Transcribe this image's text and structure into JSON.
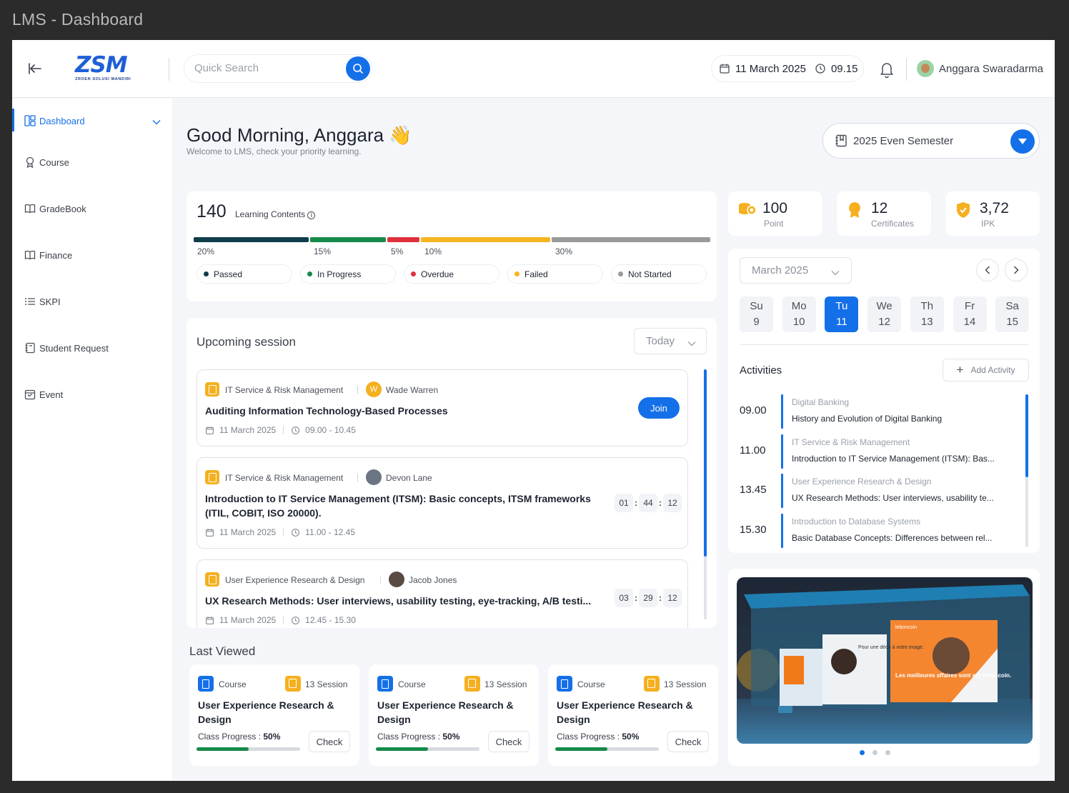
{
  "window_title": "LMS - Dashboard",
  "header": {
    "logo_text": "ZSM",
    "logo_subtitle": "ZROEN SOLUSI MANDIRI",
    "search_placeholder": "Quick Search",
    "date": "11 March 2025",
    "time": "09.15",
    "user_name": "Anggara Swaradarma"
  },
  "sidebar": {
    "items": [
      {
        "label": "Dashboard",
        "icon": "dashboard-icon",
        "active": true
      },
      {
        "label": "Course",
        "icon": "award-icon"
      },
      {
        "label": "GradeBook",
        "icon": "book-open-icon"
      },
      {
        "label": "Finance",
        "icon": "book-open-icon"
      },
      {
        "label": "SKPI",
        "icon": "list-icon"
      },
      {
        "label": "Student Request",
        "icon": "notebook-icon"
      },
      {
        "label": "Event",
        "icon": "calendar-icon"
      }
    ]
  },
  "greeting": {
    "title": "Good Morning, Anggara",
    "emoji": "👋",
    "subtitle": "Welcome to LMS, check your priority learning."
  },
  "semester": {
    "label": "2025 Even Semester"
  },
  "learning_contents": {
    "count": "140",
    "label": "Learning Contents",
    "segments": [
      {
        "label": "Passed",
        "percent_label": "20%",
        "color": "#0f3d4a"
      },
      {
        "label": "In Progress",
        "percent_label": "15%",
        "color": "#168a4a"
      },
      {
        "label": "Overdue",
        "percent_label": "5%",
        "color": "#e0303e"
      },
      {
        "label": "Failed",
        "percent_label": "10%",
        "color": "#f5b51f"
      },
      {
        "label": "Not Started",
        "percent_label": "30%",
        "color": "#9a9a9a"
      }
    ]
  },
  "stats": [
    {
      "value": "100",
      "label": "Point",
      "icon": "coins-icon"
    },
    {
      "value": "12",
      "label": "Certificates",
      "icon": "medal-icon"
    },
    {
      "value": "3,72",
      "label": "IPK",
      "icon": "shield-check-icon"
    }
  ],
  "upcoming": {
    "title": "Upcoming session",
    "filter": "Today",
    "sessions": [
      {
        "course": "IT Service & Risk Management",
        "teacher": "Wade Warren",
        "teacher_initial": "W",
        "title": "Auditing Information Technology-Based Processes",
        "date": "11 March 2025",
        "time": "09.00 - 10.45",
        "action": "Join"
      },
      {
        "course": "IT Service & Risk Management",
        "teacher": "Devon Lane",
        "title": "Introduction to IT Service Management (ITSM): Basic concepts, ITSM frameworks (ITIL, COBIT, ISO 20000).",
        "date": "11 March 2025",
        "time": "11.00 - 12.45",
        "countdown": [
          "01",
          "44",
          "12"
        ]
      },
      {
        "course": "User Experience Research & Design",
        "teacher": "Jacob Jones",
        "title": "UX Research Methods: User interviews, usability testing, eye-tracking, A/B testi...",
        "date": "11 March 2025",
        "time": "12.45 - 15.30",
        "countdown": [
          "03",
          "29",
          "12"
        ]
      }
    ]
  },
  "last_viewed": {
    "title": "Last Viewed",
    "items": [
      {
        "type": "Course",
        "sessions": "13 Session",
        "title": "User Experience Research & Design",
        "progress_label": "Class Progress :",
        "progress": "50%",
        "progress_value": 0.5,
        "action": "Check"
      },
      {
        "type": "Course",
        "sessions": "13 Session",
        "title": "User Experience Research & Design",
        "progress_label": "Class Progress :",
        "progress": "50%",
        "progress_value": 0.5,
        "action": "Check"
      },
      {
        "type": "Course",
        "sessions": "13 Session",
        "title": "User Experience Research & Design",
        "progress_label": "Class Progress :",
        "progress": "50%",
        "progress_value": 0.5,
        "action": "Check"
      }
    ]
  },
  "calendar": {
    "month": "March 2025",
    "days": [
      {
        "name": "Su",
        "num": "9"
      },
      {
        "name": "Mo",
        "num": "10"
      },
      {
        "name": "Tu",
        "num": "11",
        "selected": true
      },
      {
        "name": "We",
        "num": "12"
      },
      {
        "name": "Th",
        "num": "13"
      },
      {
        "name": "Fr",
        "num": "14"
      },
      {
        "name": "Sa",
        "num": "15"
      }
    ],
    "activities_title": "Activities",
    "add_activity": "Add Activity",
    "activities": [
      {
        "time": "09.00",
        "course": "Digital Banking",
        "title": "History and Evolution of Digital Banking"
      },
      {
        "time": "11.00",
        "course": "IT Service & Risk Management",
        "title": "Introduction to IT Service Management (ITSM): Bas..."
      },
      {
        "time": "13.45",
        "course": "User Experience Research & Design",
        "title": "UX Research Methods: User interviews, usability te..."
      },
      {
        "time": "15.30",
        "course": "Introduction to Database Systems",
        "title": "Basic Database Concepts: Differences between rel..."
      }
    ]
  },
  "banner": {
    "ad_text_1": "Pour une déco à votre image.",
    "ad_text_2": "Les meilleures affaires sont sur leboncoin.",
    "brand": "leboncoin"
  },
  "colors": {
    "accent": "#1470e8",
    "warning": "#f5b01f",
    "success": "#168a4a"
  }
}
